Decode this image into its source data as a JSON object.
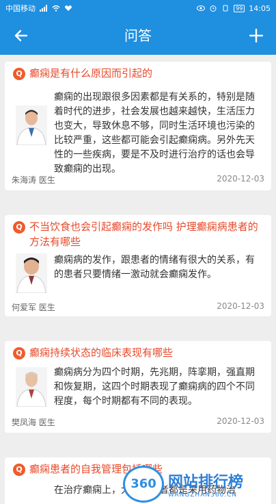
{
  "status": {
    "carrier": "中国移动",
    "battery": "99",
    "time": "14:05"
  },
  "header": {
    "title": "问答",
    "back_icon": "arrow-left-icon",
    "add_icon": "plus-icon"
  },
  "colors": {
    "primary": "#1f8fe0",
    "question": "#e8492a",
    "badge": "#ef5b2c"
  },
  "badge_letter": "Q",
  "items": [
    {
      "question": "癫痫是有什么原因而引起的",
      "answer": "癫痫的出现跟很多因素都是有关系的，特别是随着时代的进步，社会发展也越来越快，生活压力也变大，导致休息不够，同时生活环境也污染的比较严重，这些都可能会引起癫痫病。另外先天性的一些疾病，要是不及时进行治疗的话也会导致癫痫的出现。",
      "doctor": "朱海涛  医生",
      "date": "2020-12-03"
    },
    {
      "question": "不当饮食也会引起癫痫的发作吗 护理癫痫病患者的方法有哪些",
      "answer": "癫痫病的发作，跟患者的情绪有很大的关系，有的患者只要情绪一激动就会癫痫发作。",
      "doctor": "何爱军  医生",
      "date": "2020-12-03"
    },
    {
      "question": "癫痫持续状态的临床表现有哪些",
      "answer": "癫痫病分为四个时期，先兆期，阵挛期，强直期和恢复期，这四个时期表现了癫痫病的四个不同程度，每个时期都有不同的表现。",
      "doctor": "樊凤海  医生",
      "date": "2020-12-03"
    },
    {
      "question": "癫痫患者的自我管理包括哪些",
      "answer": "在治疗癫痫上，大多数患者都是采用药物治"
    }
  ],
  "watermark": {
    "logo": "360",
    "main": "网站排行榜",
    "sub": "WANGZHAN360.CN"
  }
}
